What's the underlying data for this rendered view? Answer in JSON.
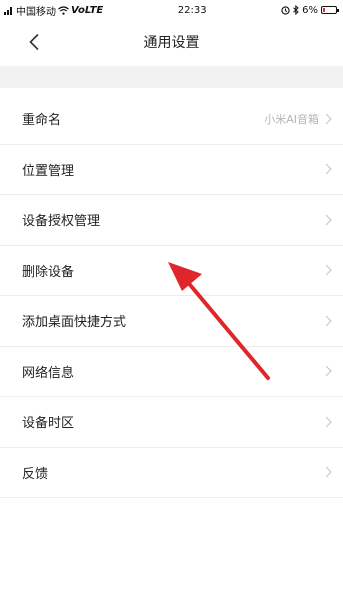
{
  "status_bar": {
    "carrier": "中国移动",
    "network": "VoLTE",
    "time": "22:33",
    "battery": "6%",
    "battery_level": 0.06
  },
  "nav": {
    "title": "通用设置",
    "back_icon": "chevron-left-icon"
  },
  "settings": {
    "items": [
      {
        "label": "重命名",
        "value": "小米AI音箱"
      },
      {
        "label": "位置管理",
        "value": ""
      },
      {
        "label": "设备授权管理",
        "value": ""
      },
      {
        "label": "删除设备",
        "value": ""
      },
      {
        "label": "添加桌面快捷方式",
        "value": ""
      },
      {
        "label": "网络信息",
        "value": ""
      },
      {
        "label": "设备时区",
        "value": ""
      },
      {
        "label": "反馈",
        "value": ""
      }
    ]
  },
  "colors": {
    "annotation_arrow": "#e0262a",
    "chevron": "#c8c8c8",
    "band": "#f2f2f2"
  }
}
